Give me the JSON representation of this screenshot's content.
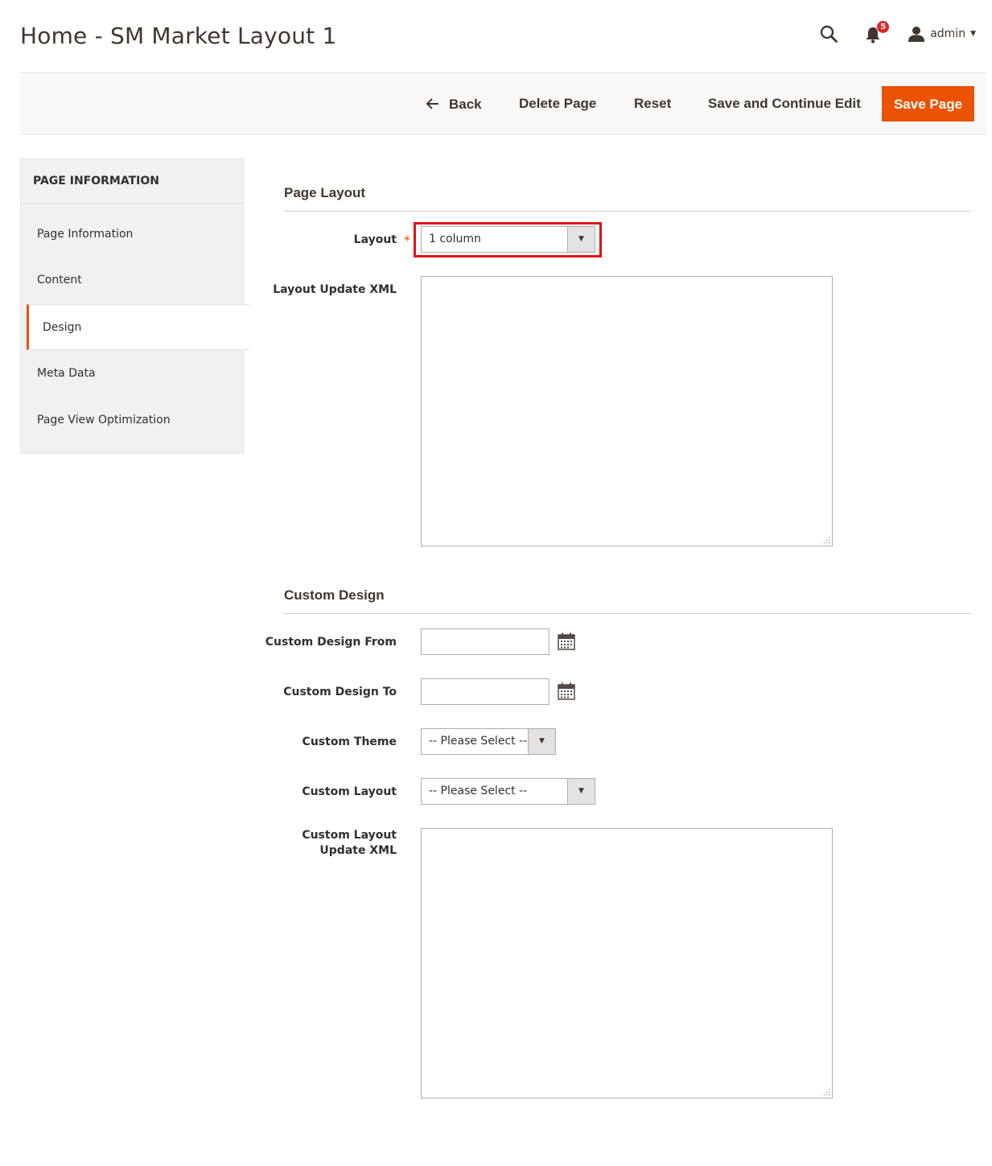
{
  "header": {
    "title": "Home - SM Market Layout 1",
    "notifications_count": "5",
    "user": "admin",
    "icons": [
      "search-icon",
      "bell-icon",
      "user-icon",
      "caret-down-icon"
    ]
  },
  "toolbar": {
    "back_label": "Back",
    "delete_label": "Delete Page",
    "reset_label": "Reset",
    "save_continue_label": "Save and Continue Edit",
    "save_label": "Save Page",
    "accent_color": "#eb5202"
  },
  "sidebar": {
    "title": "PAGE INFORMATION",
    "items": [
      {
        "label": "Page Information"
      },
      {
        "label": "Content"
      },
      {
        "label": "Design"
      },
      {
        "label": "Meta Data"
      },
      {
        "label": "Page View Optimization"
      }
    ],
    "active_item": "Design"
  },
  "page_layout": {
    "title": "Page Layout",
    "layout_label": "Layout",
    "layout_value": "1 column",
    "layout_update_xml_label": "Layout Update XML",
    "layout_update_xml_value": ""
  },
  "custom_design": {
    "title": "Custom Design",
    "from_label": "Custom Design From",
    "from_value": "",
    "to_label": "Custom Design To",
    "to_value": "",
    "theme_label": "Custom Theme",
    "theme_value": "-- Please Select --",
    "layout_label": "Custom Layout",
    "layout_value": "-- Please Select --",
    "layout_update_xml_label_line1": "Custom Layout",
    "layout_update_xml_label_line2": "Update XML",
    "layout_update_xml_value": ""
  }
}
